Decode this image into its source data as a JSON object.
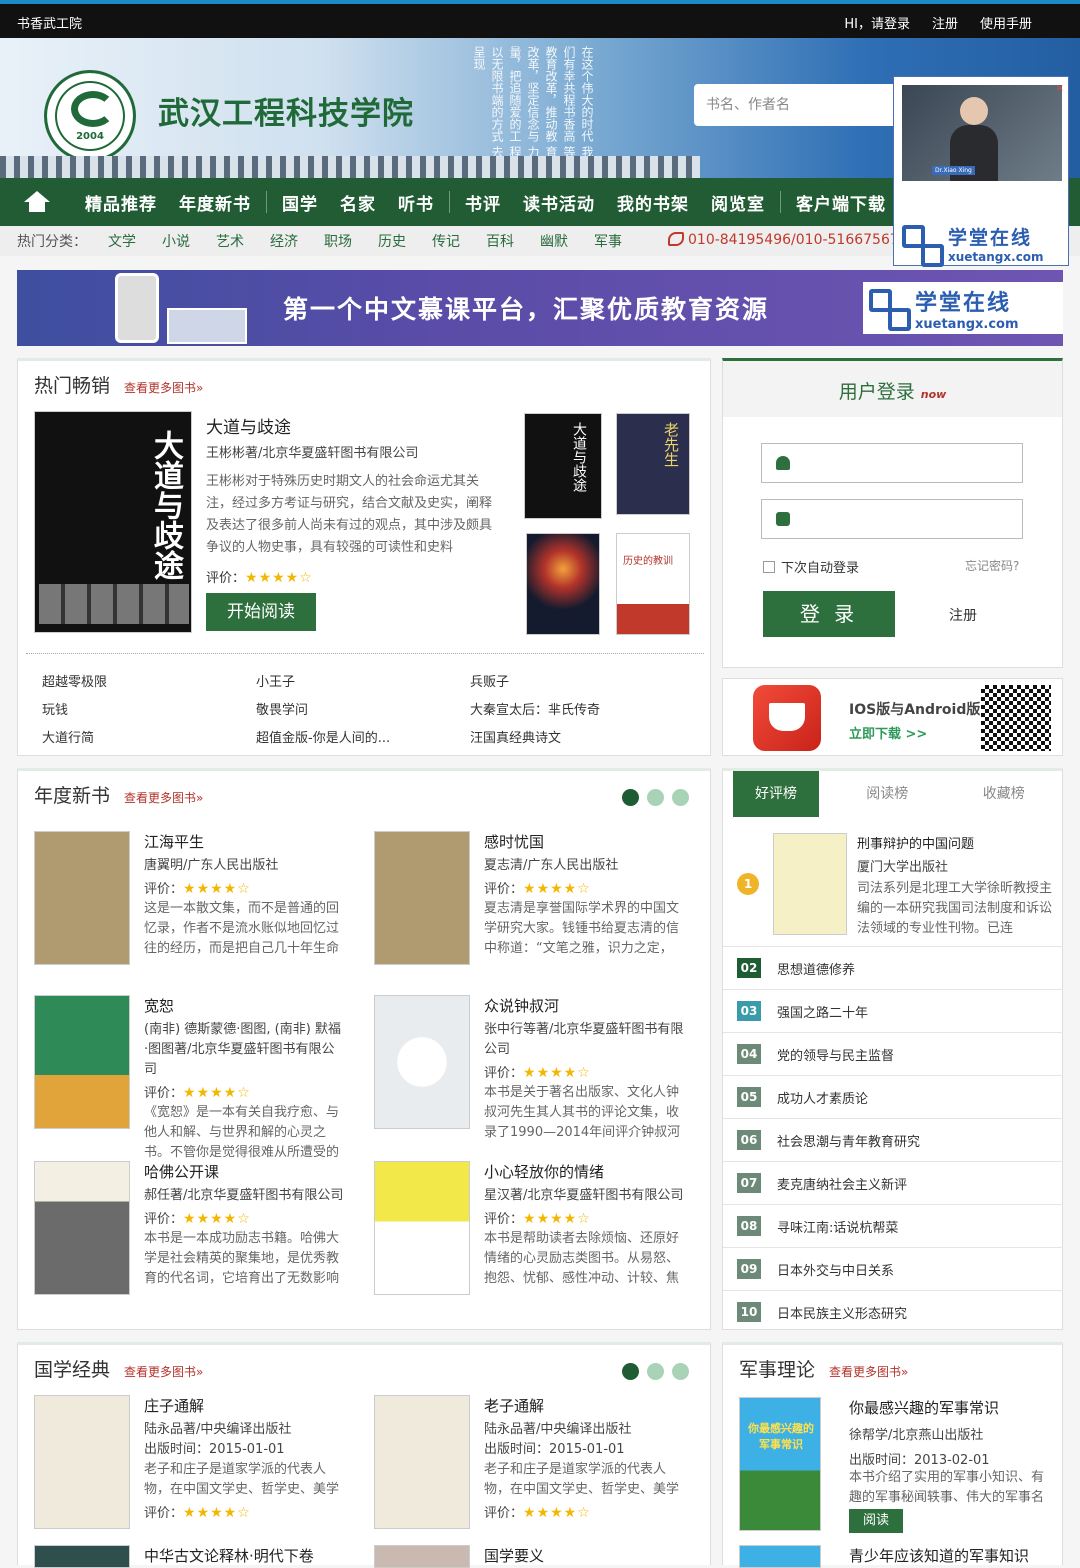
{
  "topbar": {
    "site": "书香武工院",
    "login": "HI，请登录",
    "register": "注册",
    "manual": "使用手册"
  },
  "header": {
    "school": "武汉工程科技学院",
    "logo_year": "2004",
    "poem": "在这个伟大的时代 我们有幸共程书香高 等教育改革，推动教 育改革，坚定信念与 力量，把追随爱的工 程以无限书端的方式 去呈现",
    "search_placeholder": "书名、作者名"
  },
  "video": {
    "caption": "Dr.Xiao Xing",
    "close": "×",
    "brand_cn": "学堂在线",
    "brand_en": "xuetangx.com"
  },
  "nav": {
    "items": [
      "精品推荐",
      "年度新书",
      "国学",
      "名家",
      "听书",
      "书评",
      "读书活动",
      "我的书架",
      "阅览室",
      "客户端下载"
    ]
  },
  "categories": {
    "label": "热门分类：",
    "items": [
      "文学",
      "小说",
      "艺术",
      "经济",
      "职场",
      "历史",
      "传记",
      "百科",
      "幽默",
      "军事"
    ],
    "phone": "010-84195496/010-51667567"
  },
  "ad": {
    "slogan": "第一个中文慕课平台，汇聚优质教育资源",
    "brand_cn": "学堂在线",
    "brand_en": "xuetangx.com"
  },
  "hot": {
    "heading": "热门畅销",
    "more": "查看更多图书»",
    "featured": {
      "title": "大道与歧途",
      "meta": "王彬彬著/北京华夏盛轩图书有限公司",
      "desc": "王彬彬对于特殊历史时期文人的社会命运尤其关注，经过多方考证与研究，结合文献及史实，阐释及表达了很多前人尚未有过的观点，其中涉及颇具争议的人物史事，具有较强的可读性和史料",
      "rating_label": "评价：",
      "stars": "★★★★☆",
      "read": "开始阅读",
      "cover_text": "大道与歧途"
    },
    "thumbs": [
      "大道与歧途",
      "老先生",
      "",
      "历史的教训"
    ],
    "list": [
      "超越零极限",
      "小王子",
      "兵贩子",
      "玩钱",
      "敬畏学问",
      "大秦宣太后：芈氏传奇",
      "大道行简",
      "超值金版-你是人间的...",
      "汪国真经典诗文"
    ]
  },
  "newbooks": {
    "heading": "年度新书",
    "more": "查看更多图书»",
    "items": [
      {
        "title": "江海平生",
        "pub": "唐翼明/广东人民出版社",
        "rating": "评价：",
        "stars": "★★★★☆",
        "desc": "这是一本散文集，而不是普通的回忆录，作者不是流水账似地回忆过往的经历，而是把自己几十年生命"
      },
      {
        "title": "感时忧国",
        "pub": "夏志清/广东人民出版社",
        "rating": "评价：",
        "stars": "★★★★☆",
        "desc": "夏志清是享誉国际学术界的中国文学研究大家。钱锺书给夏志清的信中称道：“文笔之雅，识力之定，"
      },
      {
        "title": "宽恕",
        "pub": "(南非) 德斯蒙德·图图, (南非) 默福·图图著/北京华夏盛轩图书有限公司",
        "rating": "评价：",
        "stars": "★★★★☆",
        "desc": "《宽恕》是一本有关自我疗愈、与他人和解、与世界和解的心灵之书。不管你是觉得很难从所遭受的"
      },
      {
        "title": "众说钟叔河",
        "pub": "张中行等著/北京华夏盛轩图书有限公司",
        "rating": "评价：",
        "stars": "★★★★☆",
        "desc": "本书是关于著名出版家、文化人钟叔河先生其人其书的评论文集，收录了1990—2014年间评介钟叔河"
      },
      {
        "title": "哈佛公开课",
        "pub": "郝任著/北京华夏盛轩图书有限公司",
        "rating": "评价：",
        "stars": "★★★★☆",
        "desc": "本书是一本成功励志书籍。哈佛大学是社会精英的聚集地，是优秀教育的代名词，它培育出了无数影响"
      },
      {
        "title": "小心轻放你的情绪",
        "pub": "星汉著/北京华夏盛轩图书有限公司",
        "rating": "评价：",
        "stars": "★★★★☆",
        "desc": "本书是帮助读者去除烦恼、还原好情绪的心灵励志类图书。从易怒、抱怨、忧郁、感性冲动、计较、焦"
      }
    ]
  },
  "login": {
    "title": "用户登录",
    "now": "now",
    "remember": "下次自动登录",
    "forgot": "忘记密码?",
    "submit": "登 录",
    "register": "注册"
  },
  "app": {
    "line1": "IOS版与Android版",
    "line2": "立即下载 >>"
  },
  "ranking": {
    "tabs": [
      "好评榜",
      "阅读榜",
      "收藏榜"
    ],
    "top": {
      "title": "刑事辩护的中国问题",
      "pub": "厦门大学出版社",
      "desc": "司法系列是北理工大学徐昕教授主编的一本研究我国司法制度和诉讼法领域的专业性刊物。已连"
    },
    "items": [
      {
        "n": "02",
        "t": "思想道德修养"
      },
      {
        "n": "03",
        "t": "强国之路二十年"
      },
      {
        "n": "04",
        "t": "党的领导与民主监督"
      },
      {
        "n": "05",
        "t": "成功人才素质论"
      },
      {
        "n": "06",
        "t": "社会思潮与青年教育研究"
      },
      {
        "n": "07",
        "t": "麦克唐纳社会主义新评"
      },
      {
        "n": "08",
        "t": "寻味江南:话说杭帮菜"
      },
      {
        "n": "09",
        "t": "日本外交与中日关系"
      },
      {
        "n": "10",
        "t": "日本民族主义形态研究"
      }
    ]
  },
  "guoxue": {
    "heading": "国学经典",
    "more": "查看更多图书»",
    "items": [
      {
        "title": "庄子通解",
        "pub": "陆永品著/中央编译出版社",
        "date": "出版时间：2015-01-01",
        "desc": "老子和庄子是道家学派的代表人物，在中国文学史、哲学史、美学",
        "rating": "评价：",
        "stars": "★★★★☆"
      },
      {
        "title": "老子通解",
        "pub": "陆永品著/中央编译出版社",
        "date": "出版时间：2015-01-01",
        "desc": "老子和庄子是道家学派的代表人物，在中国文学史、哲学史、美学",
        "rating": "评价：",
        "stars": "★★★★☆"
      },
      {
        "title": "中华古文论释林·明代下卷"
      },
      {
        "title": "国学要义"
      }
    ]
  },
  "military": {
    "heading": "军事理论",
    "more": "查看更多图书»",
    "book": {
      "title": "你最感兴趣的军事常识",
      "pub": "徐帮学/北京燕山出版社",
      "date": "出版时间：2013-02-01",
      "desc": "本书介绍了实用的军事小知识、有趣的军事秘闻轶事、伟大的军事名",
      "read": "阅读",
      "cover_text": "你最感兴趣的军事常识"
    },
    "next": "青少年应该知道的军事知识"
  }
}
